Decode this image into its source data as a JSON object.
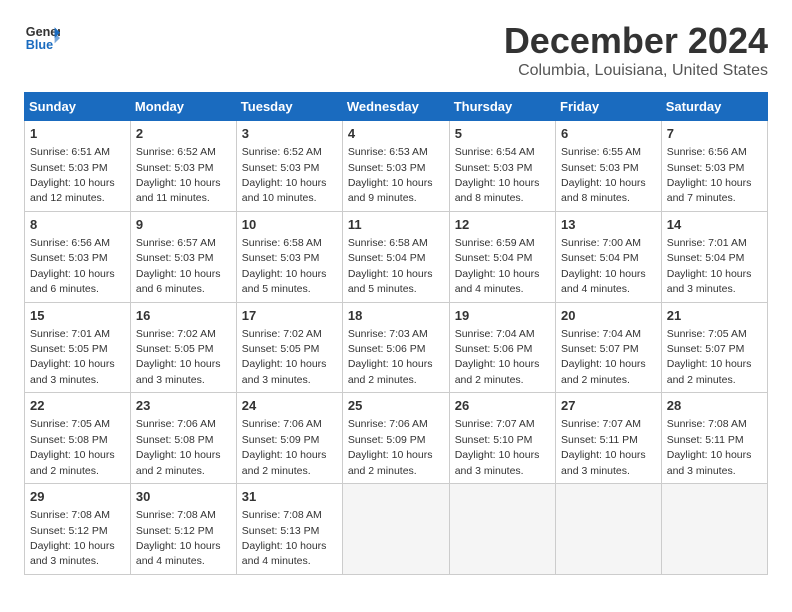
{
  "logo": {
    "text_general": "General",
    "text_blue": "Blue"
  },
  "header": {
    "month": "December 2024",
    "location": "Columbia, Louisiana, United States"
  },
  "weekdays": [
    "Sunday",
    "Monday",
    "Tuesday",
    "Wednesday",
    "Thursday",
    "Friday",
    "Saturday"
  ],
  "weeks": [
    [
      {
        "day": "1",
        "sunrise": "6:51 AM",
        "sunset": "5:03 PM",
        "daylight": "10 hours and 12 minutes."
      },
      {
        "day": "2",
        "sunrise": "6:52 AM",
        "sunset": "5:03 PM",
        "daylight": "10 hours and 11 minutes."
      },
      {
        "day": "3",
        "sunrise": "6:52 AM",
        "sunset": "5:03 PM",
        "daylight": "10 hours and 10 minutes."
      },
      {
        "day": "4",
        "sunrise": "6:53 AM",
        "sunset": "5:03 PM",
        "daylight": "10 hours and 9 minutes."
      },
      {
        "day": "5",
        "sunrise": "6:54 AM",
        "sunset": "5:03 PM",
        "daylight": "10 hours and 8 minutes."
      },
      {
        "day": "6",
        "sunrise": "6:55 AM",
        "sunset": "5:03 PM",
        "daylight": "10 hours and 8 minutes."
      },
      {
        "day": "7",
        "sunrise": "6:56 AM",
        "sunset": "5:03 PM",
        "daylight": "10 hours and 7 minutes."
      }
    ],
    [
      {
        "day": "8",
        "sunrise": "6:56 AM",
        "sunset": "5:03 PM",
        "daylight": "10 hours and 6 minutes."
      },
      {
        "day": "9",
        "sunrise": "6:57 AM",
        "sunset": "5:03 PM",
        "daylight": "10 hours and 6 minutes."
      },
      {
        "day": "10",
        "sunrise": "6:58 AM",
        "sunset": "5:03 PM",
        "daylight": "10 hours and 5 minutes."
      },
      {
        "day": "11",
        "sunrise": "6:58 AM",
        "sunset": "5:04 PM",
        "daylight": "10 hours and 5 minutes."
      },
      {
        "day": "12",
        "sunrise": "6:59 AM",
        "sunset": "5:04 PM",
        "daylight": "10 hours and 4 minutes."
      },
      {
        "day": "13",
        "sunrise": "7:00 AM",
        "sunset": "5:04 PM",
        "daylight": "10 hours and 4 minutes."
      },
      {
        "day": "14",
        "sunrise": "7:01 AM",
        "sunset": "5:04 PM",
        "daylight": "10 hours and 3 minutes."
      }
    ],
    [
      {
        "day": "15",
        "sunrise": "7:01 AM",
        "sunset": "5:05 PM",
        "daylight": "10 hours and 3 minutes."
      },
      {
        "day": "16",
        "sunrise": "7:02 AM",
        "sunset": "5:05 PM",
        "daylight": "10 hours and 3 minutes."
      },
      {
        "day": "17",
        "sunrise": "7:02 AM",
        "sunset": "5:05 PM",
        "daylight": "10 hours and 3 minutes."
      },
      {
        "day": "18",
        "sunrise": "7:03 AM",
        "sunset": "5:06 PM",
        "daylight": "10 hours and 2 minutes."
      },
      {
        "day": "19",
        "sunrise": "7:04 AM",
        "sunset": "5:06 PM",
        "daylight": "10 hours and 2 minutes."
      },
      {
        "day": "20",
        "sunrise": "7:04 AM",
        "sunset": "5:07 PM",
        "daylight": "10 hours and 2 minutes."
      },
      {
        "day": "21",
        "sunrise": "7:05 AM",
        "sunset": "5:07 PM",
        "daylight": "10 hours and 2 minutes."
      }
    ],
    [
      {
        "day": "22",
        "sunrise": "7:05 AM",
        "sunset": "5:08 PM",
        "daylight": "10 hours and 2 minutes."
      },
      {
        "day": "23",
        "sunrise": "7:06 AM",
        "sunset": "5:08 PM",
        "daylight": "10 hours and 2 minutes."
      },
      {
        "day": "24",
        "sunrise": "7:06 AM",
        "sunset": "5:09 PM",
        "daylight": "10 hours and 2 minutes."
      },
      {
        "day": "25",
        "sunrise": "7:06 AM",
        "sunset": "5:09 PM",
        "daylight": "10 hours and 2 minutes."
      },
      {
        "day": "26",
        "sunrise": "7:07 AM",
        "sunset": "5:10 PM",
        "daylight": "10 hours and 3 minutes."
      },
      {
        "day": "27",
        "sunrise": "7:07 AM",
        "sunset": "5:11 PM",
        "daylight": "10 hours and 3 minutes."
      },
      {
        "day": "28",
        "sunrise": "7:08 AM",
        "sunset": "5:11 PM",
        "daylight": "10 hours and 3 minutes."
      }
    ],
    [
      {
        "day": "29",
        "sunrise": "7:08 AM",
        "sunset": "5:12 PM",
        "daylight": "10 hours and 3 minutes."
      },
      {
        "day": "30",
        "sunrise": "7:08 AM",
        "sunset": "5:12 PM",
        "daylight": "10 hours and 4 minutes."
      },
      {
        "day": "31",
        "sunrise": "7:08 AM",
        "sunset": "5:13 PM",
        "daylight": "10 hours and 4 minutes."
      },
      null,
      null,
      null,
      null
    ]
  ]
}
